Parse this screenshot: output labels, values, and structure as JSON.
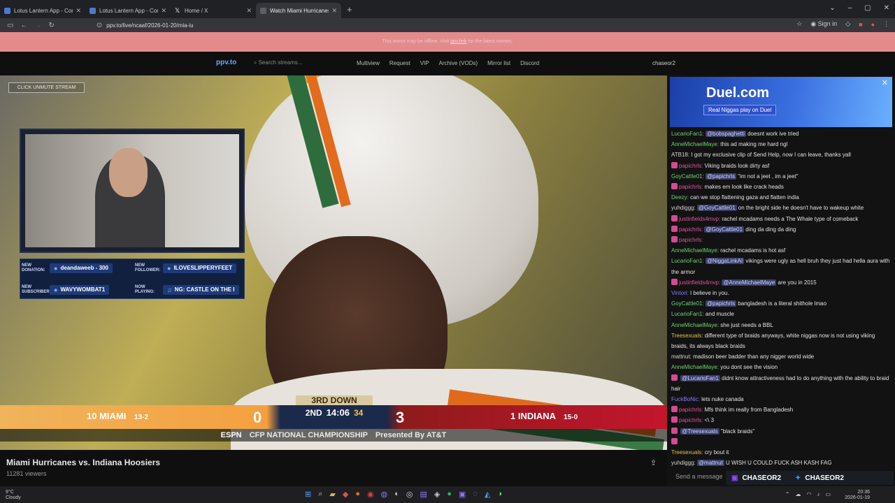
{
  "browser": {
    "tabs": [
      {
        "label": "Lotus Lantern App - Control led",
        "icon": "app-icon"
      },
      {
        "label": "Lotus Lantern App - Control led",
        "icon": "app-icon"
      },
      {
        "label": "Home / X",
        "icon": "x-icon"
      },
      {
        "label": "Watch Miami Hurricanes vs. Indi",
        "icon": "ppv-icon"
      }
    ],
    "url": "ppv.to/live/ncaaf/2026-01-20/mia-iu",
    "signin": "Sign in"
  },
  "banner": {
    "prefix": "This mirror may be offline. Visit",
    "link": "ppv.link",
    "suffix": "for the latest mirrors."
  },
  "sitenav": {
    "logo": "ppv.to",
    "search_placeholder": "Search streams...",
    "links": [
      "Multiview",
      "Request",
      "VIP",
      "Archive (VODs)",
      "Mirror list",
      "Discord"
    ],
    "user": "chaseor2"
  },
  "player": {
    "unmute": "CLICK UNMUTE STREAM",
    "alerts": {
      "donation_label": "NEW DONATION:",
      "donation": "deandaweeb - 300",
      "follower_label": "NEW FOLLOWER:",
      "follower": "ILOVESLIPPERYFEET",
      "subscriber_label": "NEW SUBSCRIBER:",
      "subscriber": "WAVYWOMBAT1",
      "playing_label": "NOW PLAYING:",
      "playing": "NG: CASTLE ON THE I"
    },
    "scoreboard": {
      "left_rank": "10",
      "left_team": "MIAMI",
      "left_record": "13-2",
      "left_score": "0",
      "down": "3RD DOWN",
      "quarter": "2ND",
      "clock": "14:06",
      "playclock": "34",
      "right_score": "3",
      "right_rank": "1",
      "right_team": "INDIANA",
      "right_record": "15-0",
      "network": "ESPN",
      "footer": "CFP NATIONAL CHAMPIONSHIP",
      "presented": "Presented By",
      "sponsor": "AT&T"
    }
  },
  "stream": {
    "title": "Miami Hurricanes vs. Indiana Hoosiers",
    "viewers": "11281 viewers"
  },
  "chat": {
    "ad_title": "Duel.com",
    "ad_sub": "Real Niggas play on Duel",
    "input_placeholder": "Send a message",
    "social_twitch": "CHASEOR2",
    "social_twitter": "CHASEOR2",
    "messages": [
      {
        "user": "LucarioFan1:",
        "color": "#6fd36f",
        "mention": "@bobspaghetti",
        "text": " doesnt work ive tried"
      },
      {
        "user": "AnneMichaelMaye:",
        "color": "#6fd36f",
        "mention": "",
        "text": " this ad making me hard ngl"
      },
      {
        "user": "ATB18:",
        "color": "#d4d4d4",
        "mention": "",
        "text": " I got my exclusive clip of Send Help, now I can leave, thanks yall"
      },
      {
        "user": "papichrls:",
        "color": "#e0559b",
        "mention": "",
        "text": " Viking braids look dirty asf"
      },
      {
        "user": "GoyCattle01:",
        "color": "#6fd36f",
        "mention": "@papichrls",
        "text": " \"im not a jeet , im a jeet\""
      },
      {
        "user": "papichrls:",
        "color": "#e0559b",
        "mention": "",
        "text": " makes em look like crack heads"
      },
      {
        "user": "Deezy:",
        "color": "#6fd36f",
        "mention": "",
        "text": " can we stop flattening gaza and flatten india"
      },
      {
        "user": "yuhdiggg:",
        "color": "#d4d4d4",
        "mention": "@GoyCattle01",
        "text": " on the bright side he doesn't have to wakeup white"
      },
      {
        "user": "justinfields4mvp:",
        "color": "#e0559b",
        "mention": "",
        "text": " rachel mcadams needs a The Whale type of comeback"
      },
      {
        "user": "papichrls:",
        "color": "#e0559b",
        "mention": "@GoyCattle01",
        "text": " ding da ding da ding"
      },
      {
        "user": "papichrls:",
        "color": "#e0559b",
        "mention": "",
        "text": ""
      },
      {
        "user": "AnneMichaelMaye:",
        "color": "#6fd36f",
        "mention": "",
        "text": " rachel mcadams is hot asf"
      },
      {
        "user": "LucarioFan1:",
        "color": "#6fd36f",
        "mention": "@NiggaLinkAI",
        "text": " vikings were ugly as hell bruh they just had hella aura with the armor"
      },
      {
        "user": "justinfields4mvp:",
        "color": "#e0559b",
        "mention": "@AnneMichaelMaye",
        "text": " are you in 2015"
      },
      {
        "user": "Vintori:",
        "color": "#8a7bff",
        "mention": "",
        "text": " I believe in you."
      },
      {
        "user": "GoyCattle01:",
        "color": "#6fd36f",
        "mention": "@papichrls",
        "text": " bangladesh is a literal shithole lmao"
      },
      {
        "user": "LucarioFan1:",
        "color": "#6fd36f",
        "mention": "",
        "text": " and muscle"
      },
      {
        "user": "AnneMichaelMaye:",
        "color": "#6fd36f",
        "mention": "",
        "text": " she just needs a BBL"
      },
      {
        "user": "Treesexuals:",
        "color": "#e6c24a",
        "mention": "",
        "text": " different type of braids anyways, white niggas now is not using viking braids, its always black braids"
      },
      {
        "user": "mattnut:",
        "color": "#d4d4d4",
        "mention": "",
        "text": " madison beer badder than any nigger world wide"
      },
      {
        "user": "AnneMichaelMaye:",
        "color": "#6fd36f",
        "mention": "",
        "text": " you dont see the vision"
      },
      {
        "user": "",
        "color": "#c2223a",
        "mention": "@LucarioFan1",
        "text": " didnt know attractiveness had to do anything with the ability to braid hair"
      },
      {
        "user": "FuckBoNic:",
        "color": "#8a7bff",
        "mention": "",
        "text": " lets nuke canada"
      },
      {
        "user": "papichrls:",
        "color": "#e0559b",
        "mention": "",
        "text": " Mfs think im really from Bangladesh"
      },
      {
        "user": "papichrls:",
        "color": "#e0559b",
        "mention": "",
        "text": " <\\ 3"
      },
      {
        "user": "",
        "color": "#c2223a",
        "mention": "@Treesexuals",
        "text": " \"black braids\""
      },
      {
        "user": "",
        "color": "#c2223a",
        "mention": "",
        "text": ""
      },
      {
        "user": "Treesexuals:",
        "color": "#e6c24a",
        "mention": "",
        "text": " cry bout it"
      },
      {
        "user": "yuhdiggg:",
        "color": "#d4d4d4",
        "mention": "@mattnut",
        "text": " U WISH U COULD FUCK ASH KASH FAG"
      }
    ]
  },
  "taskbar": {
    "weather_temp": "9°C",
    "weather_desc": "Cloudy",
    "time": "20:36",
    "date": "2026-01-19"
  }
}
